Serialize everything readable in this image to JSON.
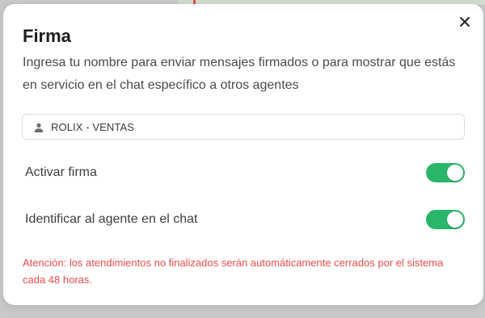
{
  "modal": {
    "title": "Firma",
    "description": "Ingresa tu nombre para enviar mensajes firmados o para mostrar que estás en servicio en el chat específico a otros agentes",
    "close_icon": "close-icon"
  },
  "name_field": {
    "icon": "user-icon",
    "value": "ROLIX - VENTAS"
  },
  "settings": [
    {
      "label": "Activar firma",
      "enabled": true
    },
    {
      "label": "Identificar al agente en el chat",
      "enabled": true
    }
  ],
  "warning": "Atención: los atendimientos no finalizados serán automáticamente cerrados por el sistema cada 48 horas.",
  "colors": {
    "toggle_on": "#2ab66a",
    "warning": "#ea4c4c",
    "title": "#1e1e1e"
  }
}
